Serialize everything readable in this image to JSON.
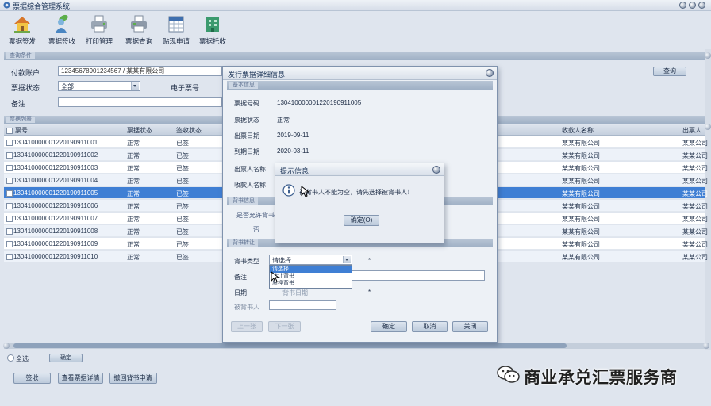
{
  "window": {
    "title": "票据综合管理系统",
    "logo_icon": "app-logo-icon",
    "controls": [
      "help-icon",
      "minimize-icon",
      "close-icon"
    ]
  },
  "toolbar": {
    "items": [
      {
        "label": "票据签发",
        "icon": "home-icon"
      },
      {
        "label": "票据签收",
        "icon": "user-leaf-icon"
      },
      {
        "label": "打印管理",
        "icon": "printer-icon"
      },
      {
        "label": "票据查询",
        "icon": "printer-icon"
      },
      {
        "label": "贴现申请",
        "icon": "calendar-icon"
      },
      {
        "label": "票据托收",
        "icon": "building-icon"
      }
    ]
  },
  "query": {
    "section_label": "查询条件",
    "payer_label": "付款账户",
    "payer_value": "12345678901234567 / 某某有限公司",
    "status_label": "票据状态",
    "status_value": "全部",
    "ticket_no_label": "电子票号",
    "remark_label": "备注",
    "remark_value": "",
    "search_label": "查询"
  },
  "list": {
    "section_label": "票据列表",
    "columns": [
      "票号",
      "票据状态",
      "签收状态",
      "收款人名称",
      "出票人"
    ],
    "selected_index": 4,
    "rows": [
      {
        "ticket": "130410000001220190911001",
        "status": "正常",
        "state": "已签",
        "payee": "某某有限公司",
        "drawer": "某某公司"
      },
      {
        "ticket": "130410000001220190911002",
        "status": "正常",
        "state": "已签",
        "payee": "某某有限公司",
        "drawer": "某某公司"
      },
      {
        "ticket": "130410000001220190911003",
        "status": "正常",
        "state": "已签",
        "payee": "某某有限公司",
        "drawer": "某某公司"
      },
      {
        "ticket": "130410000001220190911004",
        "status": "正常",
        "state": "已签",
        "payee": "某某有限公司",
        "drawer": "某某公司"
      },
      {
        "ticket": "130410000001220190911005",
        "status": "正常",
        "state": "已签",
        "payee": "某某有限公司",
        "drawer": "某某公司"
      },
      {
        "ticket": "130410000001220190911006",
        "status": "正常",
        "state": "已签",
        "payee": "某某有限公司",
        "drawer": "某某公司"
      },
      {
        "ticket": "130410000001220190911007",
        "status": "正常",
        "state": "已签",
        "payee": "某某有限公司",
        "drawer": "某某公司"
      },
      {
        "ticket": "130410000001220190911008",
        "status": "正常",
        "state": "已签",
        "payee": "某某有限公司",
        "drawer": "某某公司"
      },
      {
        "ticket": "130410000001220190911009",
        "status": "正常",
        "state": "已签",
        "payee": "某某有限公司",
        "drawer": "某某公司"
      },
      {
        "ticket": "130410000001220190911010",
        "status": "正常",
        "state": "已签",
        "payee": "某某有限公司",
        "drawer": "某某公司"
      }
    ]
  },
  "footer": {
    "select_all_label": "全选",
    "confirm_label": "确定",
    "buttons": [
      "签收",
      "查看票据详情",
      "撤回背书申请"
    ]
  },
  "detail_dialog": {
    "title": "发行票据详细信息",
    "basic_section": "基本信息",
    "fields": [
      {
        "label": "票据号码",
        "value": "130410000001220190911005"
      },
      {
        "label": "票据状态",
        "value": "正常"
      },
      {
        "label": "出票日期",
        "value": "2019-09-11"
      },
      {
        "label": "到期日期",
        "value": "2020-03-11"
      },
      {
        "label": "出票人名称",
        "value": ""
      },
      {
        "label": "收款人名称",
        "value": ""
      }
    ],
    "endorse_section": "背书信息",
    "allow_endorse_label": "是否允许背书",
    "allow_endorse_value": "否",
    "transfer_section": "背书转让",
    "endorse_type_label": "背书类型",
    "endorse_type_value": "请选择",
    "endorse_type_options": [
      "请选择",
      "转让背书",
      "质押背书"
    ],
    "required_mark": "*",
    "remark_label": "备注",
    "date_label": "日期",
    "date_placeholder": "背书日期",
    "endorsee_label": "被背书人",
    "buttons": {
      "prev": "上一张",
      "next": "下一张",
      "ok": "确定",
      "cancel": "取消",
      "close": "关闭"
    }
  },
  "message_box": {
    "title": "提示信息",
    "icon": "info-icon",
    "message": "被背书人不能为空，请先选择被背书人！",
    "ok_label": "确定(O)"
  },
  "watermark": {
    "icon": "wechat-icon",
    "text": "商业承兑汇票服务商"
  },
  "colors": {
    "background": "#dfe5ee",
    "section_bar": "#a9b8cb",
    "selected_row": "#3f7fd4",
    "dialog_bg": "#edf1f6"
  }
}
